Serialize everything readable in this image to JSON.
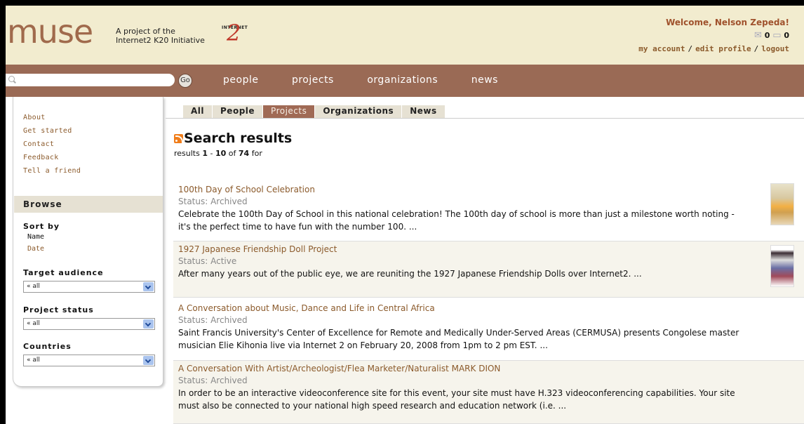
{
  "header": {
    "logo": "muse",
    "tagline_line1": "A project of the",
    "tagline_line2": "Internet2 K20 Initiative",
    "partner_small": "INTERNET",
    "partner_big": "2",
    "welcome": "Welcome, Nelson Zepeda!",
    "mail_count": "0",
    "chat_count": "0",
    "links": {
      "account": "my account",
      "edit": "edit profile",
      "logout": "logout"
    },
    "separator": "/"
  },
  "nav": {
    "search_placeholder": "",
    "go_label": "Go",
    "items": [
      "people",
      "projects",
      "organizations",
      "news"
    ]
  },
  "sidebar": {
    "links": [
      "About",
      "Get started",
      "Contact",
      "Feedback",
      "Tell a friend"
    ],
    "browse_title": "Browse",
    "sort_by": {
      "title": "Sort by",
      "options": [
        "Name",
        "Date"
      ]
    },
    "target_audience": {
      "title": "Target audience",
      "value": "« all"
    },
    "project_status": {
      "title": "Project status",
      "value": "« all"
    },
    "countries": {
      "title": "Countries",
      "value": "« all"
    }
  },
  "tabs": [
    "All",
    "People",
    "Projects",
    "Organizations",
    "News"
  ],
  "active_tab": "Projects",
  "results": {
    "title": "Search results",
    "meta_prefix": "results ",
    "range_start": "1",
    "range_sep": " - ",
    "range_end": "10",
    "of_word": " of ",
    "total": "74",
    "for_word": " for",
    "items": [
      {
        "title": "100th Day of School Celebration",
        "status": "Status: Archived",
        "desc": "Celebrate the 100th Day of School in this national celebration! The 100th day of school is more than just a milestone worth noting - it's the perfect time to have fun with the number 100. ..."
      },
      {
        "title": "1927 Japanese Friendship Doll Project",
        "status": "Status: Active",
        "desc": "After many years out of the public eye, we are reuniting the 1927 Japanese Friendship Dolls over Internet2. ..."
      },
      {
        "title": "A Conversation about Music, Dance and Life in Central Africa",
        "status": "Status: Archived",
        "desc": "Saint Francis University's Center of Excellence for Remote and Medically Under-Served Areas (CERMUSA) presents Congolese master musician Elie Kihonia live via Internet 2 on February 20, 2008 from 1pm to 2 pm EST. ..."
      },
      {
        "title": "A Conversation With Artist/Archeologist/Flea Marketer/Naturalist MARK DION",
        "status": "Status: Archived",
        "desc": "In order to be an interactive videoconference site for this event, your site must have H.323 videoconferencing capabilities. Your site must also be connected to your national high speed research and education network (i.e. ..."
      }
    ]
  },
  "colors": {
    "brand_brown": "#9a6a55",
    "header_bg": "#f2eccf",
    "link": "#8b5a2b"
  }
}
